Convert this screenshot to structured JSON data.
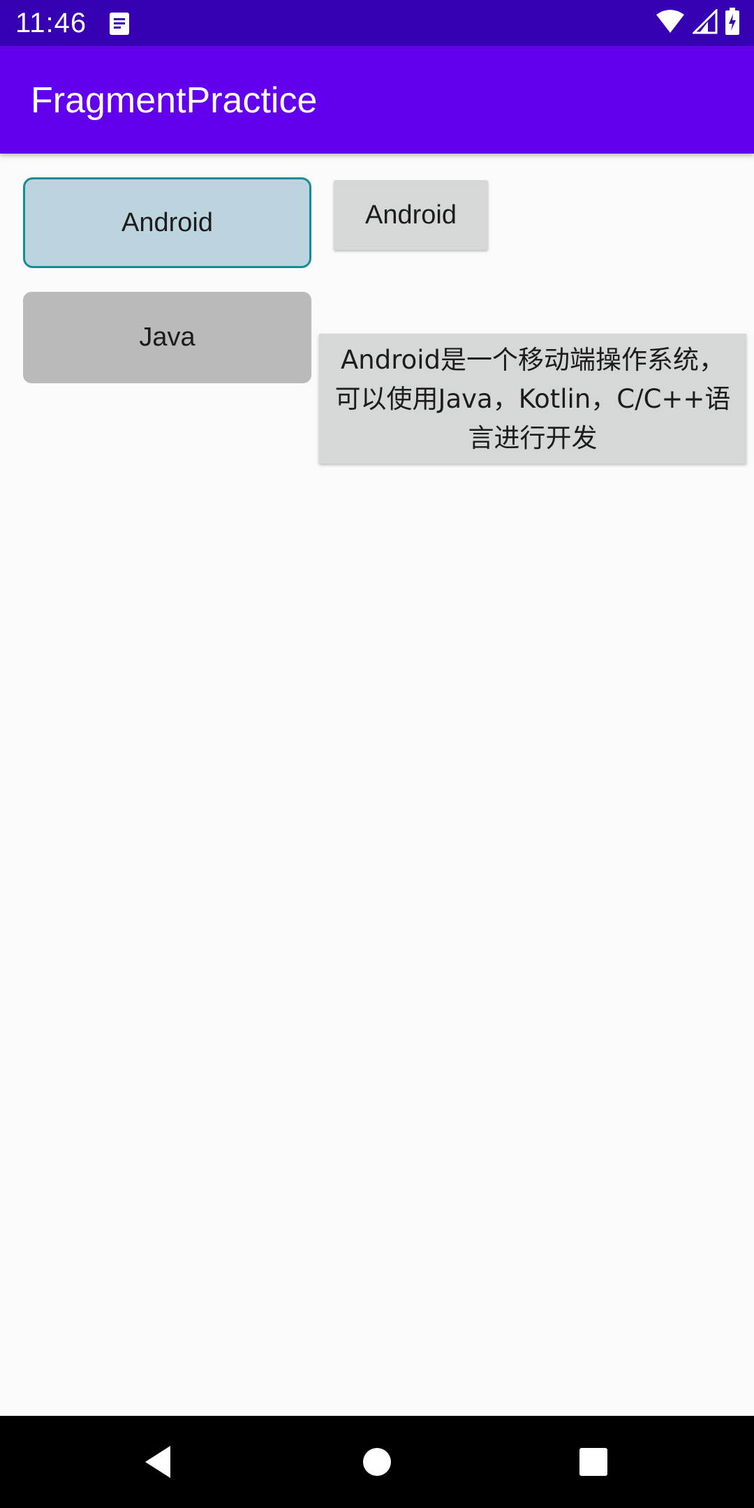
{
  "status_bar": {
    "time": "11:46",
    "notification_icon": "document-icon",
    "wifi_icon": "wifi-icon",
    "signal_icon": "signal-icon",
    "battery_icon": "battery-charging-icon"
  },
  "app_bar": {
    "title": "FragmentPractice",
    "color": "#6200ee"
  },
  "left_fragment": {
    "android_button_label": "Android",
    "java_button_label": "Java"
  },
  "right_fragment": {
    "android_button_label": "Android",
    "description": "Android是一个移动端操作系统，可以使用Java，Kotlin，C/C++语言进行开发"
  },
  "nav_bar": {
    "back_icon": "back-triangle-icon",
    "home_icon": "home-circle-icon",
    "recents_icon": "recents-square-icon"
  }
}
